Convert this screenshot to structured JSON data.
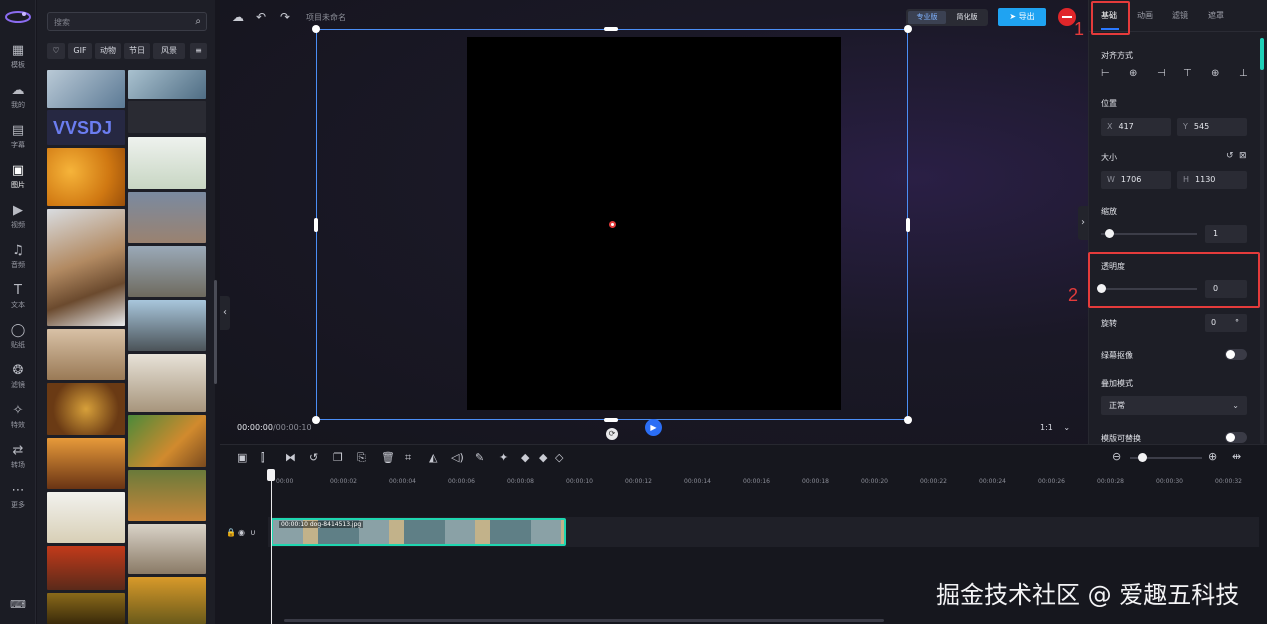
{
  "rail": {
    "items": [
      {
        "label": "模板",
        "icon": "template-icon"
      },
      {
        "label": "我的",
        "icon": "cloud-upload-icon"
      },
      {
        "label": "字幕",
        "icon": "subtitle-icon"
      },
      {
        "label": "图片",
        "icon": "image-icon"
      },
      {
        "label": "视频",
        "icon": "video-icon"
      },
      {
        "label": "音频",
        "icon": "music-icon"
      },
      {
        "label": "文本",
        "icon": "text-icon"
      },
      {
        "label": "贴纸",
        "icon": "sticker-icon"
      },
      {
        "label": "滤镜",
        "icon": "filter-icon"
      },
      {
        "label": "特效",
        "icon": "effect-icon"
      },
      {
        "label": "转场",
        "icon": "transition-icon"
      },
      {
        "label": "更多",
        "icon": "more-icon"
      }
    ],
    "active": "图片"
  },
  "library": {
    "search_placeholder": "搜索",
    "chips": [
      "GIF",
      "动物",
      "节日",
      "风景"
    ]
  },
  "topbar": {
    "project_name": "项目未命名",
    "mode_pro": "专业版",
    "mode_simple": "简化版",
    "export_label": "导出"
  },
  "player": {
    "current_time": "00:00:00",
    "total_time": "/00:00:10",
    "ratio": "1:1"
  },
  "props": {
    "tabs": [
      "基础",
      "动画",
      "滤镜",
      "遮罩"
    ],
    "align_label": "对齐方式",
    "position_label": "位置",
    "pos_x_key": "X",
    "pos_x": "417",
    "pos_y_key": "Y",
    "pos_y": "545",
    "size_label": "大小",
    "size_w_key": "W",
    "size_w": "1706",
    "size_h_key": "H",
    "size_h": "1130",
    "scale_label": "缩放",
    "scale_value": "1",
    "opacity_label": "透明度",
    "opacity_value": "0",
    "rotate_label": "旋转",
    "rotate_value": "0",
    "rotate_unit": "°",
    "greenscreen_label": "绿幕抠像",
    "blend_label": "叠加模式",
    "blend_value": "正常",
    "replaceable_label": "模版可替换"
  },
  "annotations": {
    "one": "1",
    "two": "2"
  },
  "timeline": {
    "ticks": [
      "00:00",
      "00:00:02",
      "00:00:04",
      "00:00:06",
      "00:00:08",
      "00:00:10",
      "00:00:12",
      "00:00:14",
      "00:00:16",
      "00:00:18",
      "00:00:20",
      "00:00:22",
      "00:00:24",
      "00:00:26",
      "00:00:28",
      "00:00:30",
      "00:00:32"
    ],
    "clip_label": "00:00:10 dog-8414513.jpg"
  },
  "watermark": "掘金技术社区 @ 爱趣五科技"
}
